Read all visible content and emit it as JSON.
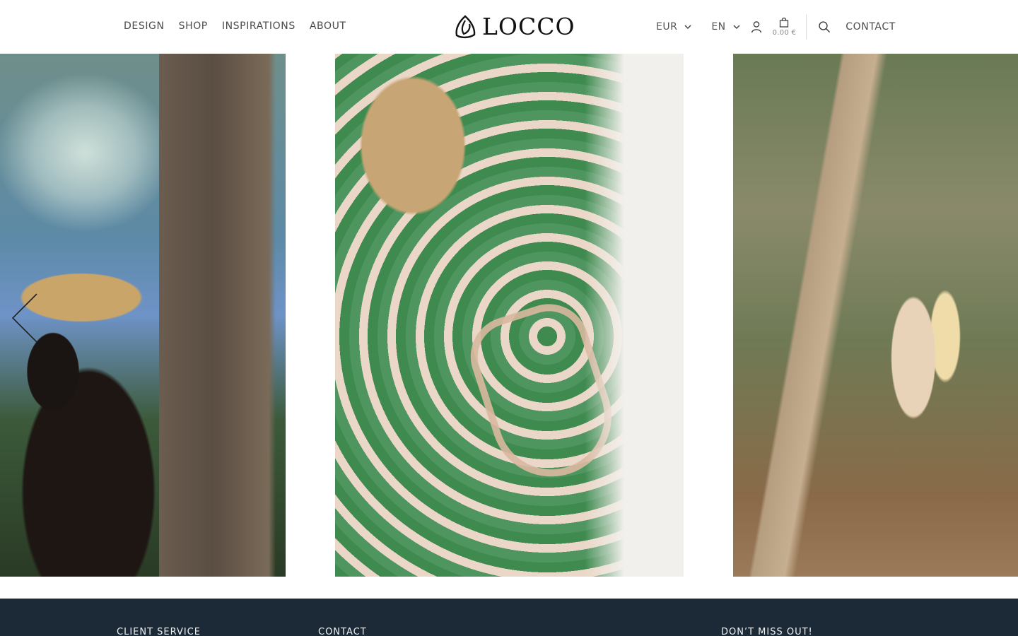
{
  "header": {
    "nav_left": [
      "DESIGN",
      "SHOP",
      "INSPIRATIONS",
      "ABOUT"
    ],
    "logo_text": "LOCCO",
    "currency": "EUR",
    "language": "EN",
    "cart_total": "0.00 €",
    "contact": "CONTACT"
  },
  "icons": {
    "logo_mark": "locco-logo-mark",
    "user": "user-icon",
    "cart": "shopping-bag-icon",
    "search": "search-icon",
    "prev": "chevron-left-icon",
    "dropdown": "chevron-down-icon"
  },
  "gallery": {
    "photos": [
      "photo-1",
      "photo-2",
      "photo-3"
    ]
  },
  "footer": {
    "headings": [
      "CLIENT SERVICE",
      "CONTACT",
      "DON’T MISS OUT!"
    ]
  },
  "colors": {
    "footer_bg": "#1b2a36",
    "text": "#4a4a4a"
  }
}
